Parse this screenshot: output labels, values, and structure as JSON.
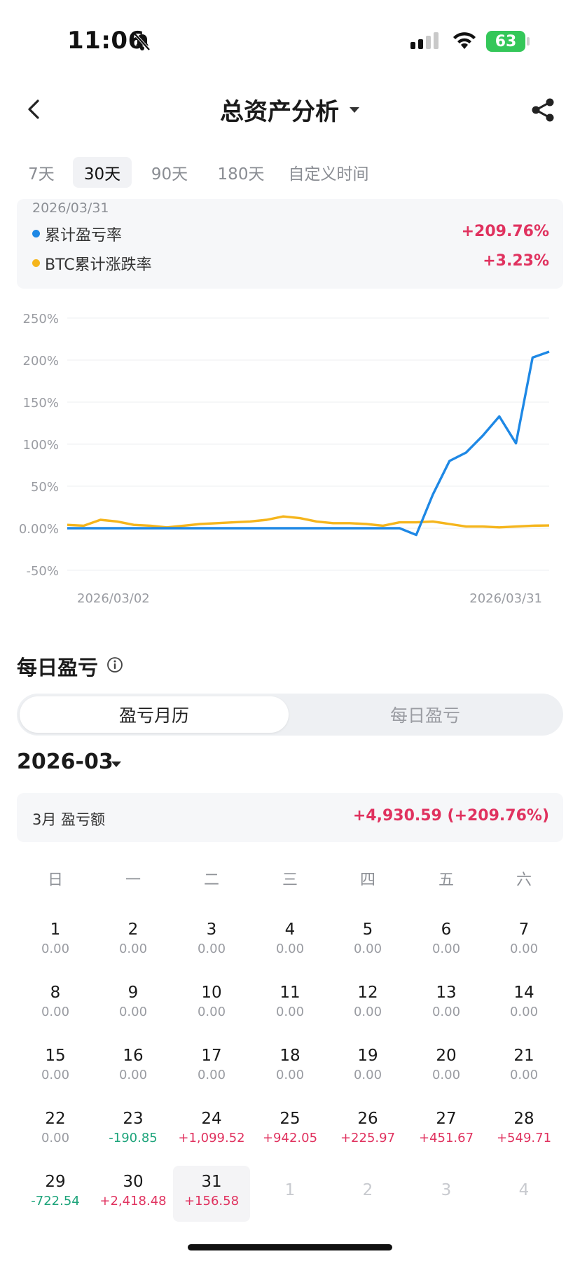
{
  "status": {
    "time": "11:06",
    "battery": "63"
  },
  "nav": {
    "title": "总资产分析"
  },
  "tabs": [
    {
      "label": "7天",
      "active": false
    },
    {
      "label": "30天",
      "active": true
    },
    {
      "label": "90天",
      "active": false
    },
    {
      "label": "180天",
      "active": false
    },
    {
      "label": "自定义时间",
      "active": false
    }
  ],
  "summary": {
    "date": "2026/03/31",
    "items": [
      {
        "label": "累计盈亏率",
        "value": "+209.76%",
        "color": "#1e88e5"
      },
      {
        "label": "BTC累计涨跌率",
        "value": "+3.23%",
        "color": "#f5b51c"
      }
    ]
  },
  "chart_data": {
    "type": "line",
    "y_ticks": [
      "250%",
      "200%",
      "150%",
      "100%",
      "50%",
      "0.00%",
      "-50%"
    ],
    "ylim": [
      -50,
      250
    ],
    "x_labels": [
      "2026/03/02",
      "2026/03/31"
    ],
    "grid": true,
    "series": [
      {
        "name": "累计盈亏率",
        "color": "#1e88e5",
        "values": [
          0,
          0,
          0,
          0,
          0,
          0,
          0,
          0,
          0,
          0,
          0,
          0,
          0,
          0,
          0,
          0,
          0,
          0,
          0,
          0,
          0,
          -8,
          40,
          80,
          90,
          110,
          133,
          101,
          203,
          210
        ]
      },
      {
        "name": "BTC累计涨跌率",
        "color": "#f5b51c",
        "values": [
          4,
          3,
          10,
          8,
          4,
          3,
          1,
          3,
          5,
          6,
          7,
          8,
          10,
          14,
          12,
          8,
          6,
          6,
          5,
          3,
          7,
          7,
          8,
          5,
          2,
          2,
          1,
          2,
          3,
          3.23
        ]
      }
    ]
  },
  "daily": {
    "title": "每日盈亏",
    "seg_calendar": "盈亏月历",
    "seg_daily": "每日盈亏",
    "month": "2026-03",
    "month_label": "3月 盈亏额",
    "month_value": "+4,930.59 (+209.76%)"
  },
  "weekdays": [
    "日",
    "一",
    "二",
    "三",
    "四",
    "五",
    "六"
  ],
  "calendar": [
    [
      {
        "d": "1",
        "v": "0.00"
      },
      {
        "d": "2",
        "v": "0.00"
      },
      {
        "d": "3",
        "v": "0.00"
      },
      {
        "d": "4",
        "v": "0.00"
      },
      {
        "d": "5",
        "v": "0.00"
      },
      {
        "d": "6",
        "v": "0.00"
      },
      {
        "d": "7",
        "v": "0.00"
      }
    ],
    [
      {
        "d": "8",
        "v": "0.00"
      },
      {
        "d": "9",
        "v": "0.00"
      },
      {
        "d": "10",
        "v": "0.00"
      },
      {
        "d": "11",
        "v": "0.00"
      },
      {
        "d": "12",
        "v": "0.00"
      },
      {
        "d": "13",
        "v": "0.00"
      },
      {
        "d": "14",
        "v": "0.00"
      }
    ],
    [
      {
        "d": "15",
        "v": "0.00"
      },
      {
        "d": "16",
        "v": "0.00"
      },
      {
        "d": "17",
        "v": "0.00"
      },
      {
        "d": "18",
        "v": "0.00"
      },
      {
        "d": "19",
        "v": "0.00"
      },
      {
        "d": "20",
        "v": "0.00"
      },
      {
        "d": "21",
        "v": "0.00"
      }
    ],
    [
      {
        "d": "22",
        "v": "0.00"
      },
      {
        "d": "23",
        "v": "-190.85",
        "s": "neg"
      },
      {
        "d": "24",
        "v": "+1,099.52",
        "s": "pos"
      },
      {
        "d": "25",
        "v": "+942.05",
        "s": "pos"
      },
      {
        "d": "26",
        "v": "+225.97",
        "s": "pos"
      },
      {
        "d": "27",
        "v": "+451.67",
        "s": "pos"
      },
      {
        "d": "28",
        "v": "+549.71",
        "s": "pos"
      }
    ],
    [
      {
        "d": "29",
        "v": "-722.54",
        "s": "neg"
      },
      {
        "d": "30",
        "v": "+2,418.48",
        "s": "pos"
      },
      {
        "d": "31",
        "v": "+156.58",
        "s": "pos",
        "today": true
      },
      {
        "d": "1",
        "other": true
      },
      {
        "d": "2",
        "other": true
      },
      {
        "d": "3",
        "other": true
      },
      {
        "d": "4",
        "other": true
      }
    ]
  ]
}
